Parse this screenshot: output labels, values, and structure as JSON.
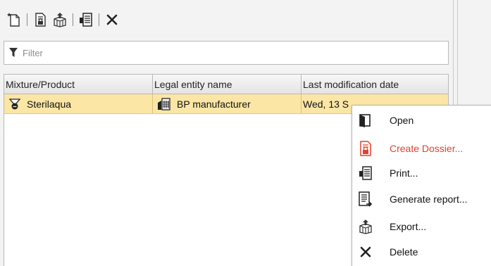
{
  "toolbar": {
    "buttons": [
      {
        "icon": "new-document-icon"
      },
      {
        "icon": "create-dossier-icon"
      },
      {
        "icon": "export-icon"
      },
      {
        "icon": "print-icon"
      },
      {
        "icon": "delete-x-icon"
      }
    ]
  },
  "filter": {
    "placeholder": "Filter",
    "value": "",
    "icon": "funnel-icon"
  },
  "table": {
    "columns": [
      "Mixture/Product",
      "Legal entity name",
      "Last modification date"
    ],
    "rows": [
      {
        "product": "Sterilaqua",
        "product_icon": "mixture-icon",
        "legal_entity": "BP manufacturer",
        "legal_entity_icon": "building-icon",
        "last_modified": "Wed, 13 S"
      }
    ],
    "selected_row_color": "#fbe6a5"
  },
  "context_menu": {
    "items": [
      {
        "label": "Open",
        "icon": "open-icon"
      },
      {
        "label": "Create Dossier...",
        "icon": "create-dossier-icon",
        "color": "#e0412e"
      },
      {
        "label": "Print...",
        "icon": "print-icon"
      },
      {
        "label": "Generate report...",
        "icon": "report-icon"
      },
      {
        "label": "Export...",
        "icon": "export-icon"
      },
      {
        "label": "Delete",
        "icon": "delete-x-icon"
      }
    ]
  }
}
